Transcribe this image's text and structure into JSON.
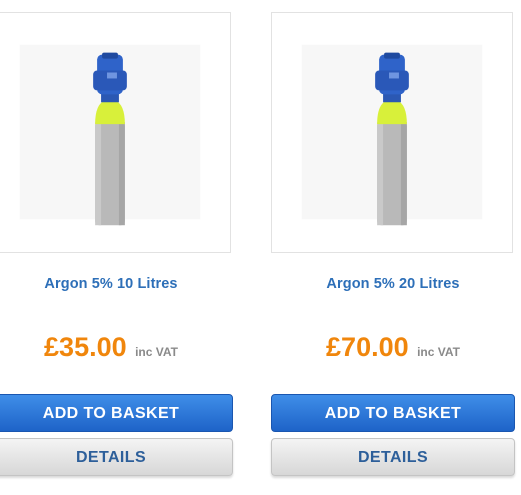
{
  "products": [
    {
      "name": "Argon 5% 10 Litres",
      "price": "£35.00",
      "vat_note": "inc VAT",
      "basket_label": "ADD TO BASKET",
      "details_label": "DETAILS"
    },
    {
      "name": "Argon 5% 20 Litres",
      "price": "£70.00",
      "vat_note": "inc VAT",
      "basket_label": "ADD TO BASKET",
      "details_label": "DETAILS"
    }
  ],
  "colors": {
    "title": "#2d6fb8",
    "price": "#f0860c",
    "basket_button": "#2f78dc",
    "details_button": "#e4e4e4"
  },
  "icons": {
    "product_image": "gas-cylinder-icon"
  }
}
